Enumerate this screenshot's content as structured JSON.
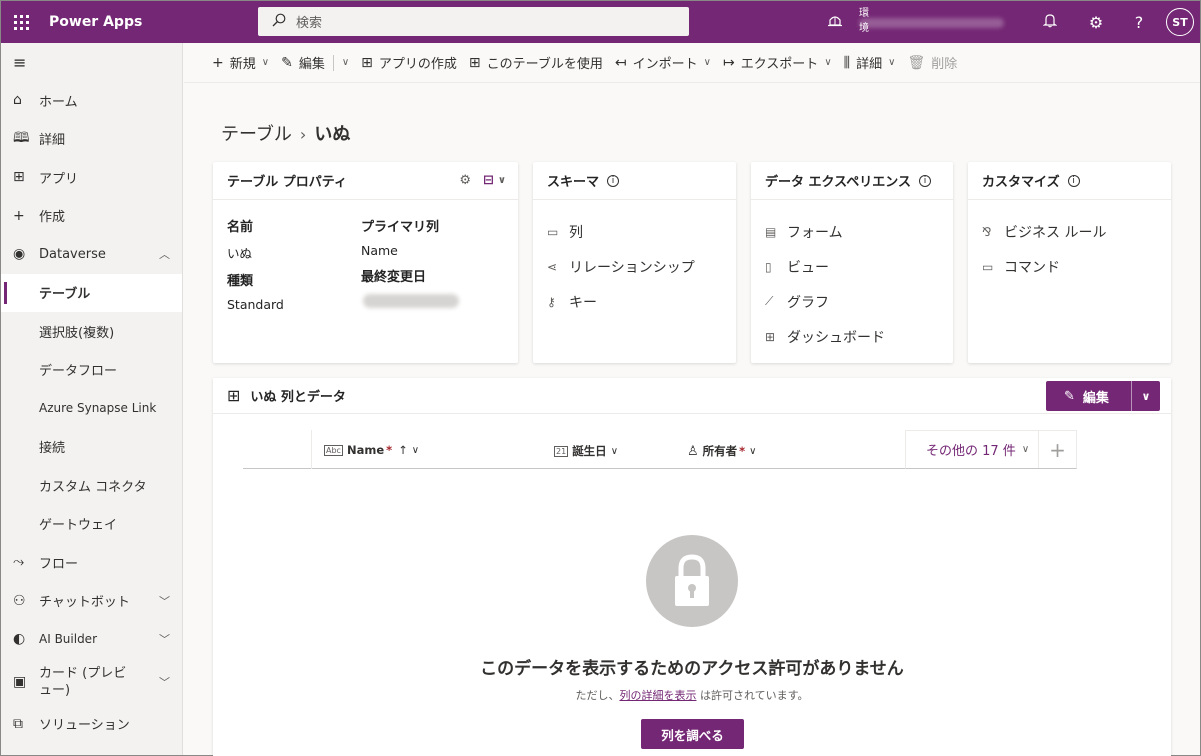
{
  "header": {
    "app_name": "Power Apps",
    "search_placeholder": "検索",
    "environment_label": "環境",
    "avatar_initials": "ST"
  },
  "sidebar": {
    "items": [
      {
        "label": "ホーム",
        "icon": "home-icon"
      },
      {
        "label": "詳細",
        "icon": "book-icon"
      },
      {
        "label": "アプリ",
        "icon": "apps-icon"
      },
      {
        "label": "作成",
        "icon": "plus-icon"
      },
      {
        "label": "Dataverse",
        "icon": "dataverse-icon",
        "expanded": true
      },
      {
        "label": "テーブル",
        "active": true
      },
      {
        "label": "選択肢(複数)"
      },
      {
        "label": "データフロー"
      },
      {
        "label": "Azure Synapse Link"
      },
      {
        "label": "接続"
      },
      {
        "label": "カスタム コネクタ"
      },
      {
        "label": "ゲートウェイ"
      },
      {
        "label": "フロー",
        "icon": "flow-icon"
      },
      {
        "label": "チャットボット",
        "icon": "bot-icon"
      },
      {
        "label": "AI Builder",
        "icon": "ai-builder-icon"
      },
      {
        "label": "カード (プレビュー)",
        "icon": "card-icon"
      },
      {
        "label": "ソリューション",
        "icon": "solution-icon"
      }
    ]
  },
  "commandbar": {
    "new": "新規",
    "edit": "編集",
    "create_app": "アプリの作成",
    "use_table": "このテーブルを使用",
    "import": "インポート",
    "export": "エクスポート",
    "details": "詳細",
    "delete": "削除"
  },
  "breadcrumb": {
    "parent": "テーブル",
    "current": "いぬ"
  },
  "cards": {
    "properties": {
      "title": "テーブル プロパティ",
      "name_label": "名前",
      "name_value": "いぬ",
      "type_label": "種類",
      "type_value": "Standard",
      "primary_label": "プライマリ列",
      "primary_value": "Name",
      "modified_label": "最終変更日"
    },
    "schema": {
      "title": "スキーマ",
      "links": [
        "列",
        "リレーションシップ",
        "キー"
      ]
    },
    "experiences": {
      "title": "データ エクスペリエンス",
      "links": [
        "フォーム",
        "ビュー",
        "グラフ",
        "ダッシュボード"
      ]
    },
    "customize": {
      "title": "カスタマイズ",
      "links": [
        "ビジネス ルール",
        "コマンド"
      ]
    }
  },
  "data_panel": {
    "title": "いぬ 列とデータ",
    "edit_label": "編集",
    "columns": [
      {
        "label": "Name",
        "required": true
      },
      {
        "label": "誕生日",
        "required": false
      },
      {
        "label": "所有者",
        "required": true
      }
    ],
    "more_columns": "その他の 17 件",
    "no_access_title": "このデータを表示するためのアクセス許可がありません",
    "no_access_prefix": "ただし、",
    "no_access_link": "列の詳細を表示",
    "no_access_suffix": " は許可されています。",
    "explore_button": "列を調べる"
  },
  "colors": {
    "brand": "#742774",
    "required": "#a4262c"
  }
}
